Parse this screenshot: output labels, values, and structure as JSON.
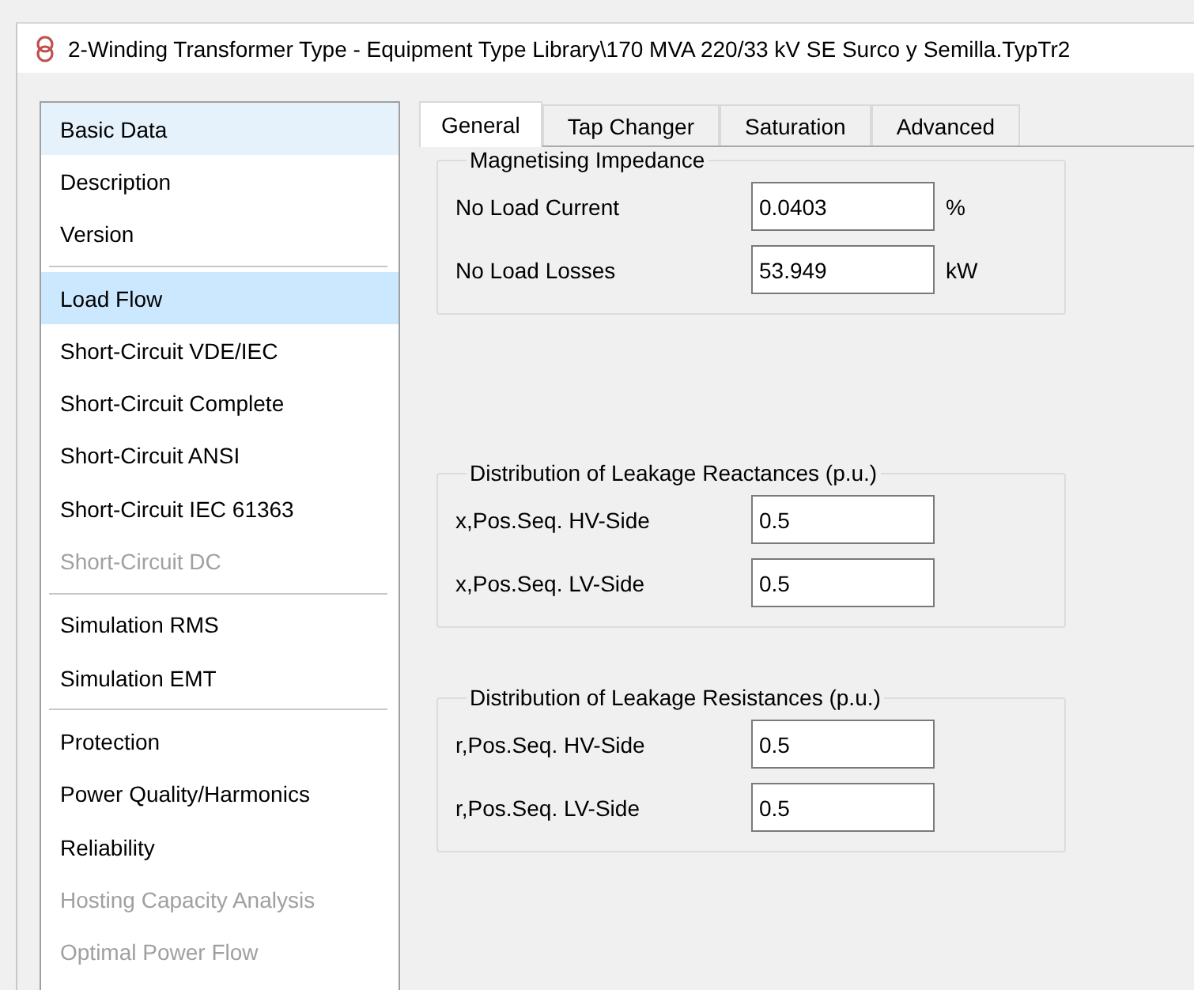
{
  "window": {
    "title": "2-Winding Transformer Type - Equipment Type Library\\170 MVA 220/33 kV SE Surco y Semilla.TypTr2"
  },
  "sidebar": {
    "groups": [
      {
        "items": [
          {
            "label": "Basic Data",
            "selected": false,
            "hovered": true,
            "disabled": false
          },
          {
            "label": "Description",
            "selected": false,
            "hovered": false,
            "disabled": false
          },
          {
            "label": "Version",
            "selected": false,
            "hovered": false,
            "disabled": false
          }
        ]
      },
      {
        "items": [
          {
            "label": "Load Flow",
            "selected": true,
            "hovered": false,
            "disabled": false
          },
          {
            "label": "Short-Circuit VDE/IEC",
            "selected": false,
            "hovered": false,
            "disabled": false
          },
          {
            "label": "Short-Circuit Complete",
            "selected": false,
            "hovered": false,
            "disabled": false
          },
          {
            "label": "Short-Circuit ANSI",
            "selected": false,
            "hovered": false,
            "disabled": false
          },
          {
            "label": "Short-Circuit IEC 61363",
            "selected": false,
            "hovered": false,
            "disabled": false
          },
          {
            "label": "Short-Circuit DC",
            "selected": false,
            "hovered": false,
            "disabled": true
          }
        ]
      },
      {
        "items": [
          {
            "label": "Simulation RMS",
            "selected": false,
            "hovered": false,
            "disabled": false
          },
          {
            "label": "Simulation EMT",
            "selected": false,
            "hovered": false,
            "disabled": false
          }
        ]
      },
      {
        "items": [
          {
            "label": "Protection",
            "selected": false,
            "hovered": false,
            "disabled": false
          },
          {
            "label": "Power Quality/Harmonics",
            "selected": false,
            "hovered": false,
            "disabled": false
          },
          {
            "label": "Reliability",
            "selected": false,
            "hovered": false,
            "disabled": false
          },
          {
            "label": "Hosting Capacity Analysis",
            "selected": false,
            "hovered": false,
            "disabled": true
          },
          {
            "label": "Optimal Power Flow",
            "selected": false,
            "hovered": false,
            "disabled": true
          }
        ]
      }
    ]
  },
  "tabs": [
    {
      "label": "General",
      "selected": true
    },
    {
      "label": "Tap Changer",
      "selected": false
    },
    {
      "label": "Saturation",
      "selected": false
    },
    {
      "label": "Advanced",
      "selected": false
    }
  ],
  "groups": [
    {
      "title": "Magnetising Impedance",
      "fields": [
        {
          "label": "No Load Current",
          "value": "0.0403",
          "unit": "%"
        },
        {
          "label": "No Load Losses",
          "value": "53.949",
          "unit": "kW"
        }
      ]
    },
    {
      "title": "Distribution of Leakage Reactances (p.u.)",
      "fields": [
        {
          "label": "x,Pos.Seq. HV-Side",
          "value": "0.5"
        },
        {
          "label": "x,Pos.Seq. LV-Side",
          "value": "0.5"
        }
      ]
    },
    {
      "title": "Distribution of Leakage Resistances (p.u.)",
      "fields": [
        {
          "label": "r,Pos.Seq. HV-Side",
          "value": "0.5"
        },
        {
          "label": "r,Pos.Seq. LV-Side",
          "value": "0.5"
        }
      ]
    }
  ]
}
